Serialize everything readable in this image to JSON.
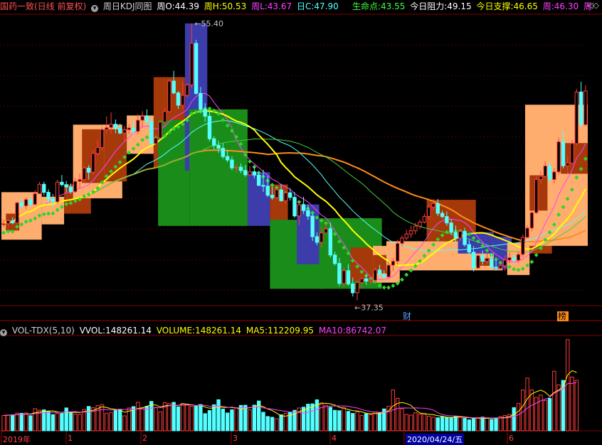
{
  "header": {
    "stock_title": "国药一致(日线 前复权)",
    "indicator_name": "周日KDJ同图",
    "wo_label": "周O:",
    "wo_value": "44.39",
    "wh_label": "周H:",
    "wh_value": "50.53",
    "wl_label": "周L:",
    "wl_value": "43.67",
    "dc_label": "日C:",
    "dc_value": "47.90",
    "life_label": "生命点:",
    "life_value": "43.55",
    "res_label": "今日阻力:",
    "res_value": "49.15",
    "sup_label": "今日支撑:",
    "sup_value": "46.65",
    "wk_label": "周:",
    "wk_value": "46.30",
    "trail": "周"
  },
  "annotations": {
    "high": "55.40",
    "low": "37.35",
    "cai": "财",
    "bang": "榜"
  },
  "volume_header": {
    "name": "VOL-TDX(5,10)",
    "vvol_label": "VVOL:",
    "vvol_value": "148261.14",
    "volume_label": "VOLUME:",
    "volume_value": "148261.14",
    "ma5_label": "MA5:",
    "ma5_value": "112209.95",
    "ma10_label": "MA10:",
    "ma10_value": "86742.07"
  },
  "x_axis_labels": [
    "2019年",
    "1",
    "2",
    "3",
    "4",
    "2020/04/24/五",
    "6"
  ],
  "colors": {
    "up": "#ff3c3c",
    "down": "#54ffff",
    "ma_yellow": "#ffff00",
    "ma_orange": "#ff8c1a",
    "ma_green": "#40d040",
    "dots": "#2fd42f",
    "peach": "#ffad6e",
    "rust": "#a5390a",
    "blue": "#3c3caa",
    "grass": "#1a8c1a"
  },
  "chart_data": {
    "type": "candlestick",
    "price_range": [
      37.35,
      55.4
    ],
    "volume_range": [
      0,
      280000
    ],
    "candles": [
      [
        42.28,
        42.6,
        42.12,
        42.35
      ],
      [
        42.35,
        42.64,
        42.11,
        42.54
      ],
      [
        42.54,
        42.77,
        42.3,
        42.4
      ],
      [
        42.4,
        43.78,
        42.4,
        43.71
      ],
      [
        43.71,
        44.02,
        43.36,
        43.51
      ],
      [
        43.51,
        44.06,
        43.3,
        43.92
      ],
      [
        43.92,
        44.1,
        43.41,
        43.6
      ],
      [
        43.6,
        44.52,
        43.55,
        44.3
      ],
      [
        44.3,
        45.07,
        44.3,
        44.91
      ],
      [
        44.91,
        45.08,
        44.19,
        44.39
      ],
      [
        44.39,
        44.59,
        43.61,
        43.96
      ],
      [
        43.96,
        44.27,
        43.45,
        43.77
      ],
      [
        43.77,
        45.21,
        43.65,
        45.05
      ],
      [
        45.05,
        45.52,
        44.77,
        44.89
      ],
      [
        44.89,
        45.13,
        44.39,
        44.74
      ],
      [
        44.74,
        44.97,
        44.29,
        44.43
      ],
      [
        44.43,
        45.33,
        44.36,
        45.1
      ],
      [
        45.1,
        45.61,
        44.65,
        45.23
      ],
      [
        45.23,
        46.11,
        45.04,
        45.97
      ],
      [
        45.97,
        46.17,
        45.22,
        45.7
      ],
      [
        45.7,
        47.14,
        45.51,
        46.92
      ],
      [
        46.92,
        47.81,
        46.81,
        47.31
      ],
      [
        47.31,
        48.65,
        47.13,
        48.48
      ],
      [
        48.48,
        49.33,
        48.22,
        48.61
      ],
      [
        48.61,
        49.6,
        48.21,
        48.83
      ],
      [
        48.83,
        49.14,
        48.24,
        48.56
      ],
      [
        48.56,
        48.87,
        48.19,
        48.25
      ],
      [
        48.25,
        48.73,
        47.64,
        48.47
      ],
      [
        48.47,
        48.84,
        48.17,
        48.59
      ],
      [
        48.59,
        49.08,
        48.06,
        48.36
      ],
      [
        48.36,
        49.49,
        48.19,
        49.09
      ],
      [
        49.09,
        49.68,
        48.65,
        49.35
      ],
      [
        49.35,
        49.8,
        48.79,
        49.0
      ],
      [
        49.0,
        49.29,
        47.42,
        47.56
      ],
      [
        47.56,
        48.14,
        47.49,
        47.93
      ],
      [
        47.93,
        49.09,
        47.91,
        48.97
      ],
      [
        48.97,
        49.88,
        48.59,
        49.66
      ],
      [
        49.66,
        51.78,
        49.57,
        51.64
      ],
      [
        51.64,
        52.31,
        50.78,
        50.87
      ],
      [
        50.87,
        50.98,
        49.83,
        50.07
      ],
      [
        50.07,
        51.62,
        49.77,
        50.71
      ],
      [
        50.71,
        51.51,
        50.55,
        51.39
      ],
      [
        51.39,
        55.4,
        51.17,
        54.1
      ],
      [
        54.1,
        54.33,
        50.75,
        50.84
      ],
      [
        50.84,
        51.26,
        49.53,
        49.8
      ],
      [
        49.8,
        50.2,
        48.99,
        49.35
      ],
      [
        49.35,
        49.69,
        47.72,
        47.88
      ],
      [
        47.88,
        48.05,
        47.18,
        47.45
      ],
      [
        47.45,
        47.75,
        46.96,
        47.26
      ],
      [
        47.26,
        47.59,
        46.58,
        46.72
      ],
      [
        46.72,
        47.13,
        46.35,
        46.5
      ],
      [
        46.5,
        46.74,
        45.82,
        45.98
      ],
      [
        45.98,
        46.2,
        45.69,
        46.03
      ],
      [
        46.03,
        46.27,
        45.64,
        45.81
      ],
      [
        45.81,
        46.17,
        45.41,
        45.53
      ],
      [
        45.53,
        46.1,
        45.46,
        45.73
      ],
      [
        45.73,
        46.04,
        45.3,
        45.51
      ],
      [
        45.51,
        45.7,
        44.79,
        44.84
      ],
      [
        44.84,
        45.86,
        44.41,
        44.79
      ],
      [
        44.79,
        45.46,
        44.08,
        44.2
      ],
      [
        44.2,
        44.76,
        43.9,
        44.04
      ],
      [
        44.04,
        44.66,
        43.97,
        44.55
      ],
      [
        44.55,
        44.94,
        43.78,
        43.84
      ],
      [
        43.84,
        44.46,
        43.64,
        44.36
      ],
      [
        44.36,
        44.66,
        43.85,
        44.06
      ],
      [
        44.06,
        44.41,
        42.73,
        42.85
      ],
      [
        42.85,
        43.87,
        42.23,
        43.58
      ],
      [
        43.58,
        44.1,
        42.98,
        43.2
      ],
      [
        43.2,
        43.6,
        42.59,
        42.84
      ],
      [
        42.84,
        43.0,
        41.22,
        41.5
      ],
      [
        41.5,
        41.77,
        40.94,
        41.13
      ],
      [
        41.13,
        42.15,
        40.78,
        41.74
      ],
      [
        41.74,
        42.39,
        41.69,
        42.0
      ],
      [
        42.0,
        42.43,
        40.14,
        40.3
      ],
      [
        40.3,
        40.51,
        39.62,
        39.75
      ],
      [
        39.75,
        40.11,
        38.28,
        38.45
      ],
      [
        38.45,
        39.47,
        38.21,
        39.28
      ],
      [
        39.28,
        39.71,
        38.3,
        38.42
      ],
      [
        38.42,
        38.83,
        37.6,
        37.84
      ],
      [
        37.84,
        38.66,
        37.35,
        38.51
      ],
      [
        38.51,
        38.84,
        38.1,
        38.75
      ],
      [
        38.75,
        39.0,
        38.36,
        38.6
      ],
      [
        38.6,
        38.94,
        38.39,
        38.66
      ],
      [
        38.66,
        39.48,
        38.46,
        39.33
      ],
      [
        39.33,
        39.66,
        38.78,
        39.02
      ],
      [
        39.02,
        39.3,
        38.72,
        38.87
      ],
      [
        38.87,
        39.9,
        38.87,
        39.64
      ],
      [
        39.64,
        40.11,
        39.24,
        39.9
      ],
      [
        39.9,
        41.3,
        39.66,
        41.06
      ],
      [
        41.06,
        41.57,
        40.87,
        41.41
      ],
      [
        41.41,
        41.93,
        41.27,
        41.67
      ],
      [
        41.67,
        42.21,
        41.42,
        41.88
      ],
      [
        41.88,
        42.4,
        41.65,
        42.18
      ],
      [
        42.18,
        42.61,
        41.99,
        42.45
      ],
      [
        42.45,
        43.0,
        42.36,
        42.82
      ],
      [
        42.82,
        43.62,
        42.61,
        43.43
      ],
      [
        43.43,
        43.95,
        43.24,
        43.65
      ],
      [
        43.65,
        43.95,
        42.85,
        43.02
      ],
      [
        43.02,
        43.19,
        42.7,
        42.81
      ],
      [
        42.81,
        43.14,
        42.2,
        42.39
      ],
      [
        42.39,
        42.66,
        41.61,
        41.78
      ],
      [
        41.78,
        42.23,
        41.08,
        41.41
      ],
      [
        41.41,
        42.0,
        41.21,
        41.84
      ],
      [
        41.84,
        42.08,
        40.85,
        40.98
      ],
      [
        40.98,
        41.29,
        40.28,
        40.49
      ],
      [
        40.49,
        40.88,
        39.23,
        39.45
      ],
      [
        39.45,
        40.43,
        39.44,
        40.26
      ],
      [
        40.26,
        40.6,
        39.67,
        39.9
      ],
      [
        39.9,
        40.38,
        39.72,
        40.07
      ],
      [
        40.07,
        40.41,
        39.37,
        39.51
      ],
      [
        39.51,
        39.97,
        39.29,
        39.44
      ],
      [
        39.44,
        39.77,
        39.28,
        39.6
      ],
      [
        39.6,
        40.27,
        39.27,
        39.97
      ],
      [
        39.97,
        40.48,
        39.76,
        40.13
      ],
      [
        40.13,
        40.36,
        39.76,
        39.96
      ],
      [
        39.96,
        40.54,
        39.81,
        40.34
      ],
      [
        40.34,
        41.65,
        40.16,
        41.45
      ],
      [
        41.45,
        42.25,
        41.38,
        42.06
      ],
      [
        42.06,
        43.21,
        41.85,
        43.06
      ],
      [
        43.06,
        45.45,
        42.96,
        45.22
      ],
      [
        45.22,
        45.78,
        44.96,
        45.43
      ],
      [
        45.43,
        46.41,
        45.35,
        46.11
      ],
      [
        46.11,
        46.36,
        45.02,
        45.22
      ],
      [
        45.22,
        45.96,
        44.97,
        45.72
      ],
      [
        45.72,
        47.96,
        45.51,
        47.69
      ],
      [
        47.69,
        48.42,
        45.94,
        46.12
      ],
      [
        46.12,
        46.72,
        45.61,
        46.3
      ],
      [
        46.3,
        47.81,
        46.3,
        47.57
      ],
      [
        47.57,
        51.14,
        47.44,
        50.93
      ],
      [
        50.93,
        51.6,
        48.69,
        48.8
      ],
      [
        48.8,
        51.36,
        48.69,
        51.0
      ]
    ],
    "volume": [
      45031,
      46322,
      46808,
      51778,
      51458,
      52359,
      44213,
      65148,
      60624,
      61592,
      57599,
      47620,
      50799,
      50961,
      67153,
      53931,
      48826,
      48632,
      63120,
      71637,
      67806,
      73812,
      77007,
      51627,
      53961,
      60049,
      63116,
      43862,
      67112,
      71052,
      83813,
      68546,
      72059,
      86342,
      68520,
      55710,
      82926,
      80062,
      83452,
      70508,
      80301,
      76355,
      71883,
      72317,
      77104,
      50402,
      59567,
      76542,
      91355,
      63815,
      52233,
      61622,
      67356,
      74431,
      75014,
      61576,
      75339,
      87564,
      54434,
      41953,
      39698,
      35474,
      47011,
      51215,
      55187,
      60296,
      67016,
      69432,
      78233,
      79221,
      91135,
      82000,
      75100,
      69000,
      60100,
      59000,
      68233,
      57000,
      51120,
      55860,
      45230,
      50120,
      47880,
      55610,
      53100,
      64200,
      72000,
      120000,
      95300,
      65000,
      48120,
      46010,
      53000,
      49000,
      51000,
      43020,
      40110,
      38230,
      41120,
      39100,
      37600,
      43120,
      41880,
      36500,
      32120,
      35600,
      38420,
      40120,
      36520,
      33410,
      37920,
      42110,
      45000,
      48000,
      68100,
      80500,
      120000,
      155000,
      120000,
      98000,
      105000,
      89000,
      95000,
      175000,
      135000,
      148000,
      268000,
      158000,
      148261
    ]
  }
}
